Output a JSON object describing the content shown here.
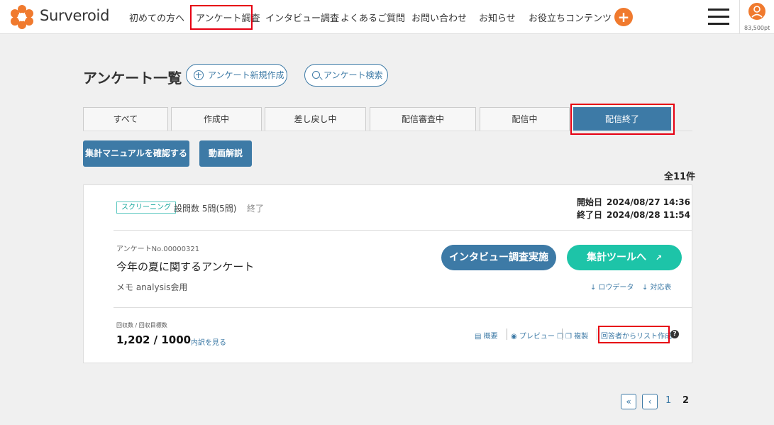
{
  "header": {
    "logo_text": "Surveroid",
    "nav": [
      "初めての方へ",
      "アンケート調査",
      "インタビュー調査",
      "よくあるご質問",
      "お問い合わせ",
      "お知らせ",
      "お役立ちコンテンツ"
    ],
    "plus_label": "+",
    "points": "83,500pt"
  },
  "page": {
    "title": "アンケート一覧",
    "new_survey": "アンケート新規作成",
    "search_survey": "アンケート検索"
  },
  "tabs": [
    "すべて",
    "作成中",
    "差し戻し中",
    "配信審査中",
    "配信中",
    "配信終了"
  ],
  "actions": {
    "manual": "集計マニュアルを確認する",
    "video": "動画解説"
  },
  "total": "全11件",
  "card": {
    "tag": "スクリーニング",
    "question_count": "設問数 5問(5問)",
    "status": "終了",
    "start_label": "開始日",
    "start_value": "2024/08/27 14:36",
    "end_label": "終了日",
    "end_value": "2024/08/28 11:54",
    "survey_no": "アンケートNo.00000321",
    "title": "今年の夏に関するアンケート",
    "memo": "メモ analysis会用",
    "interview_button": "インタビュー調査実施",
    "aggregate_button": "集計ツールへ",
    "download_raw": "ロウデータ",
    "download_table": "対応表",
    "responses_label": "回収数 / 回収目標数",
    "responses_value": "1,202 / 1000",
    "breakdown_link": "内訳を見る",
    "links": {
      "overview": "概要",
      "preview": "プレビュー",
      "copy": "複製",
      "list": "回答者からリスト作成"
    }
  },
  "pagination": {
    "first": "«",
    "prev": "‹",
    "page1": "1",
    "page2": "2"
  },
  "colors": {
    "primary": "#3d7aa6",
    "accent": "#f07a2e",
    "teal": "#1dc4a8",
    "highlight": "#e60012"
  }
}
